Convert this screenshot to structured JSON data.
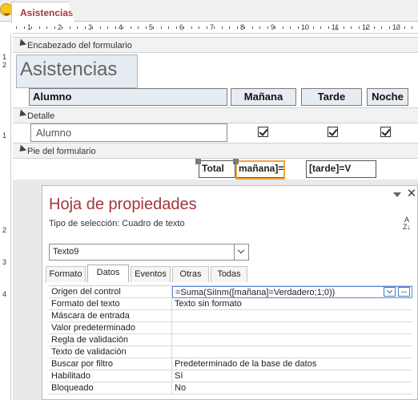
{
  "document_tab": {
    "label": "Asistencias",
    "icon": "smiley-app-icon"
  },
  "ruler": {
    "top_numbers": [
      "1",
      "2",
      "3",
      "4",
      "5",
      "6",
      "7",
      "8",
      "9",
      "10",
      "11",
      "12",
      "13"
    ],
    "left_numbers": [
      "1",
      "2",
      "1",
      "2",
      "3",
      "4"
    ]
  },
  "sections": {
    "header": "Encabezado del formulario",
    "detail": "Detalle",
    "footer": "Pie del formulario"
  },
  "form_header": {
    "title": "Asistencias",
    "columns": {
      "alumno": "Alumno",
      "manana": "Mañana",
      "tarde": "Tarde",
      "noche": "Noche"
    }
  },
  "detail": {
    "alumno_field": "Alumno",
    "checkboxes": {
      "manana": true,
      "tarde": true,
      "noche": true
    }
  },
  "form_footer": {
    "total_label": "Total",
    "manana_expr": "mañana]=",
    "tarde_expr": "[tarde]=V"
  },
  "property_sheet": {
    "title": "Hoja de propiedades",
    "selection_label": "Tipo de selección:  Cuadro de texto",
    "object_combo": "Texto9",
    "tabs": [
      "Formato",
      "Datos",
      "Eventos",
      "Otras",
      "Todas"
    ],
    "active_tab": "Datos",
    "properties": [
      {
        "name": "Origen del control",
        "value": "=Suma(SiInm([mañana]=Verdadero;1;0))"
      },
      {
        "name": "Formato del texto",
        "value": "Texto sin formato"
      },
      {
        "name": "Máscara de entrada",
        "value": ""
      },
      {
        "name": "Valor predeterminado",
        "value": ""
      },
      {
        "name": "Regla de validación",
        "value": ""
      },
      {
        "name": "Texto de validación",
        "value": ""
      },
      {
        "name": "Buscar por filtro",
        "value": "Predeterminado de la base de datos"
      },
      {
        "name": "Habilitado",
        "value": "Sí"
      },
      {
        "name": "Bloqueado",
        "value": "No"
      }
    ],
    "sort_icon_label": "A Z"
  }
}
